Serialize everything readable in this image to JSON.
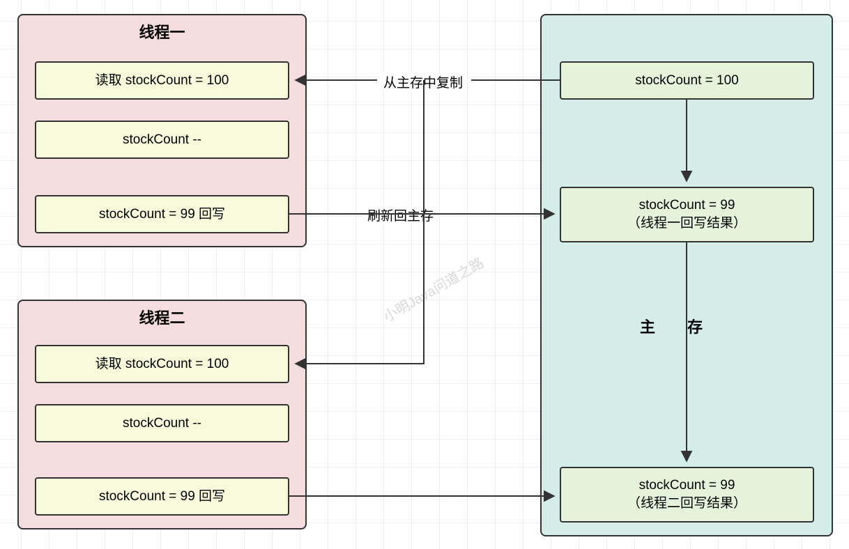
{
  "thread1": {
    "title": "线程一",
    "step1": "读取 stockCount = 100",
    "step2": "stockCount --",
    "step3": "stockCount = 99 回写"
  },
  "thread2": {
    "title": "线程二",
    "step1": "读取 stockCount = 100",
    "step2": "stockCount --",
    "step3": "stockCount = 99 回写"
  },
  "memory": {
    "label": "主存",
    "cell1": "stockCount = 100",
    "cell2_line1": "stockCount = 99",
    "cell2_line2": "（线程一回写结果）",
    "cell3_line1": "stockCount = 99",
    "cell3_line2": "（线程二回写结果）"
  },
  "edges": {
    "copy": "从主存中复制",
    "flush": "刷新回主存"
  },
  "watermark": "小明Java问道之路"
}
